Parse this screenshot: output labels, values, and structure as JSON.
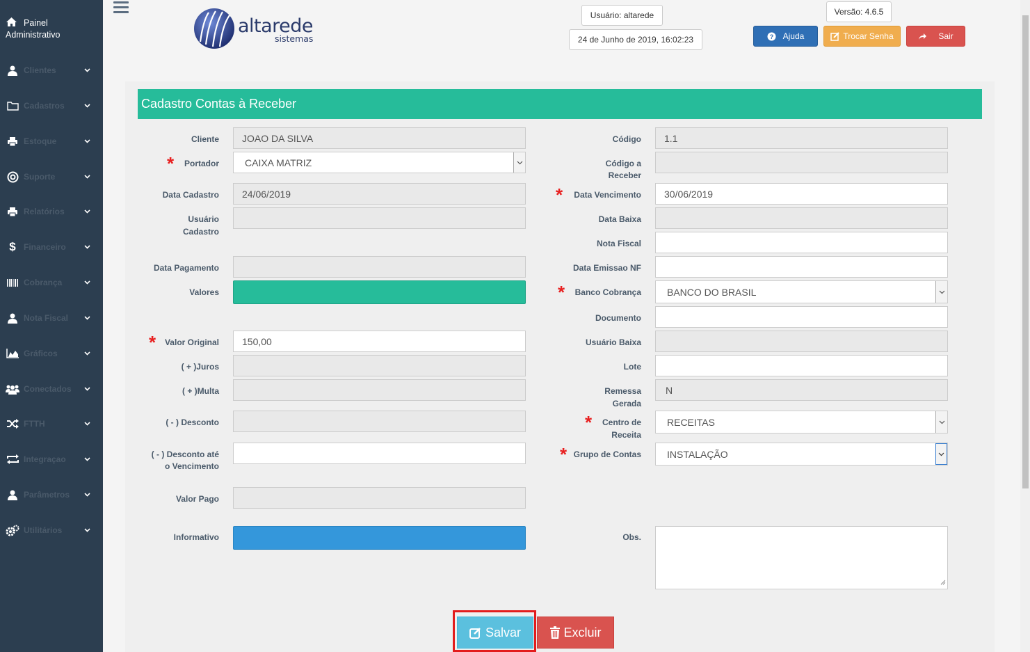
{
  "sidebar": {
    "top_label_1": "Painel",
    "top_label_2": "Administrativo",
    "items": [
      {
        "label": "Clientes",
        "icon": "user-icon"
      },
      {
        "label": "Cadastros",
        "icon": "folder-icon"
      },
      {
        "label": "Estoque",
        "icon": "print-icon"
      },
      {
        "label": "Suporte",
        "icon": "lifebuoy-icon"
      },
      {
        "label": "Relatórios",
        "icon": "print-icon"
      },
      {
        "label": "Financeiro",
        "icon": "dollar-icon"
      },
      {
        "label": "Cobrança",
        "icon": "barcode-icon"
      },
      {
        "label": "Nota Fiscal",
        "icon": "user-icon"
      },
      {
        "label": "Gráficos",
        "icon": "area-chart-icon"
      },
      {
        "label": "Conectados",
        "icon": "users-icon"
      },
      {
        "label": "FTTH",
        "icon": "random-icon"
      },
      {
        "label": "Integraçao",
        "icon": "exchange-icon"
      },
      {
        "label": "Parâmetros",
        "icon": "user-icon"
      },
      {
        "label": "Utilitários",
        "icon": "cogs-icon"
      }
    ]
  },
  "header": {
    "logo_text": "altarede",
    "logo_sub": "sistemas",
    "user": "Usuário: altarede",
    "datetime": "24 de Junho de 2019, 16:02:23",
    "version": "Versão: 4.6.5",
    "help_label": "Ajuda",
    "change_password_label": "Trocar Senha",
    "exit_label": "Sair"
  },
  "form": {
    "title": "Cadastro Contas à Receber",
    "left": {
      "cliente_label": "Cliente",
      "cliente_value": "JOAO DA SILVA",
      "portador_label": "Portador",
      "portador_value": "CAIXA MATRIZ",
      "data_cadastro_label": "Data Cadastro",
      "data_cadastro_value": "24/06/2019",
      "usuario_cadastro_label_1": "Usuário",
      "usuario_cadastro_label_2": "Cadastro",
      "data_pagamento_label": "Data Pagamento",
      "valores_label": "Valores",
      "valor_original_label": "Valor Original",
      "valor_original_value": "150,00",
      "juros_label": "( + )Juros",
      "multa_label": "( + )Multa",
      "desconto_label": "( - ) Desconto",
      "desconto_venc_label_1": "( - ) Desconto até",
      "desconto_venc_label_2": "o Vencimento",
      "valor_pago_label": "Valor Pago",
      "informativo_label": "Informativo"
    },
    "right": {
      "codigo_label": "Código",
      "codigo_value": "1.1",
      "codigo_receber_label_1": "Código a",
      "codigo_receber_label_2": "Receber",
      "data_venc_label": "Data Vencimento",
      "data_venc_value": "30/06/2019",
      "data_baixa_label": "Data Baixa",
      "nota_fiscal_label": "Nota Fiscal",
      "data_emissao_label": "Data Emissao NF",
      "banco_label": "Banco Cobrança",
      "banco_value": "BANCO DO BRASIL",
      "documento_label": "Documento",
      "usuario_baixa_label": "Usuário Baixa",
      "lote_label": "Lote",
      "remessa_label_1": "Remessa",
      "remessa_label_2": "Gerada",
      "remessa_value": "N",
      "centro_label_1": "Centro de",
      "centro_label_2": "Receita",
      "centro_value": "RECEITAS",
      "grupo_label": "Grupo de Contas",
      "grupo_value": "INSTALAÇÃO",
      "obs_label": "Obs."
    },
    "save_label": "Salvar",
    "delete_label": "Excluir"
  },
  "colors": {
    "sidebar": "#2c3e50",
    "accent": "#26bc9a",
    "info": "#3497db",
    "help": "#2f6fb5",
    "warning": "#f0ad4e",
    "danger": "#d9534f",
    "save": "#5bc0de",
    "required": "#e82020"
  }
}
